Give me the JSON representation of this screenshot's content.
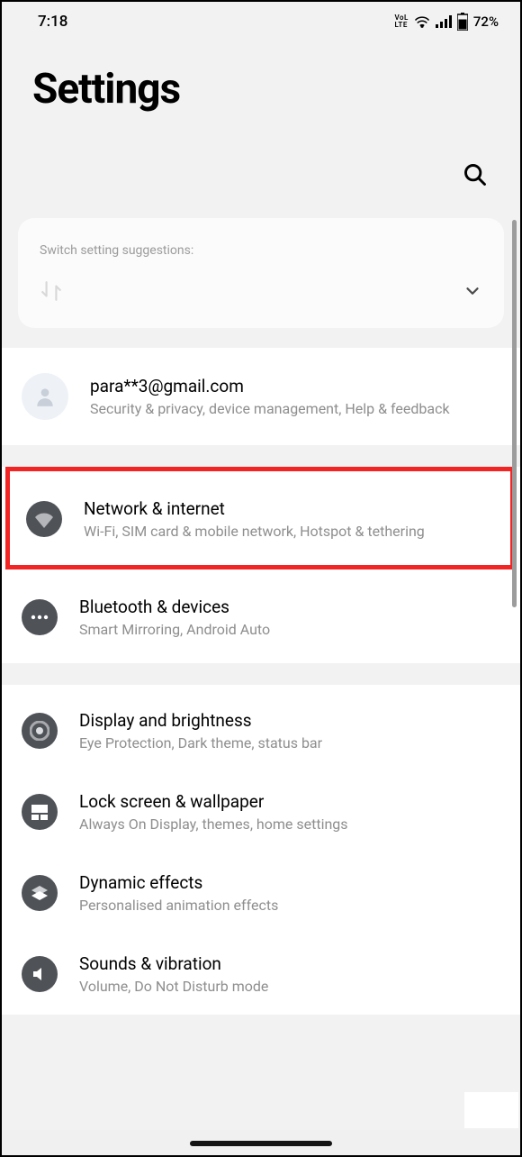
{
  "status": {
    "time": "7:18",
    "volte": "VoL\nLTE",
    "battery": "72%"
  },
  "header": {
    "title": "Settings"
  },
  "suggestions": {
    "label": "Switch setting suggestions:"
  },
  "account": {
    "email": "para**3@gmail.com",
    "sub": "Security & privacy, device management, Help & feedback"
  },
  "items": [
    {
      "title": "Network & internet",
      "sub": "Wi-Fi, SIM card & mobile network, Hotspot & tethering"
    },
    {
      "title": "Bluetooth & devices",
      "sub": "Smart Mirroring, Android Auto"
    },
    {
      "title": "Display and brightness",
      "sub": "Eye Protection, Dark theme, status bar"
    },
    {
      "title": "Lock screen & wallpaper",
      "sub": "Always On Display, themes, home settings"
    },
    {
      "title": "Dynamic effects",
      "sub": "Personalised animation effects"
    },
    {
      "title": "Sounds & vibration",
      "sub": "Volume, Do Not Disturb mode"
    }
  ]
}
